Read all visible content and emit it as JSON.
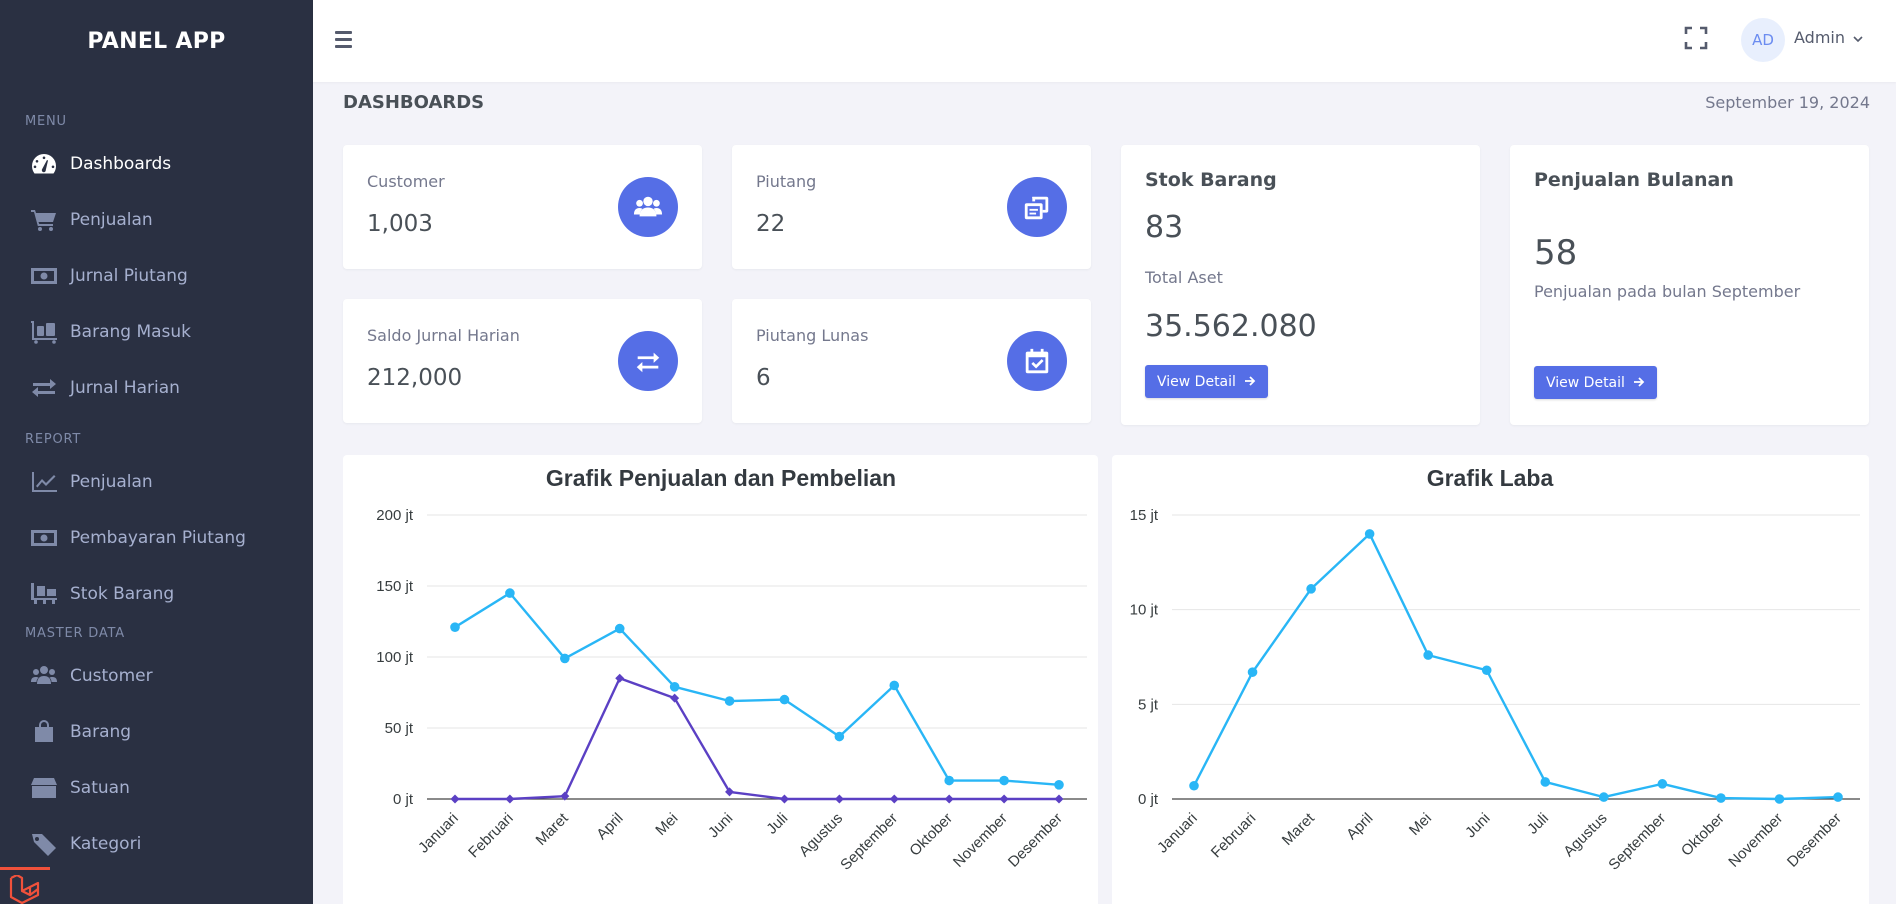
{
  "app": {
    "title": "PANEL APP"
  },
  "sidebar": {
    "sections": {
      "menu": "MENU",
      "report": "REPORT",
      "master": "MASTER DATA"
    },
    "menu_items": [
      {
        "label": "Dashboards",
        "icon": "speedometer-icon",
        "active": true
      },
      {
        "label": "Penjualan",
        "icon": "cart-icon"
      },
      {
        "label": "Jurnal Piutang",
        "icon": "money-icon"
      },
      {
        "label": "Barang Masuk",
        "icon": "luggage-cart-icon"
      },
      {
        "label": "Jurnal Harian",
        "icon": "exchange-icon"
      }
    ],
    "report_items": [
      {
        "label": "Penjualan",
        "icon": "chart-line-icon"
      },
      {
        "label": "Pembayaran Piutang",
        "icon": "money-icon"
      },
      {
        "label": "Stok Barang",
        "icon": "pallet-icon"
      }
    ],
    "master_items": [
      {
        "label": "Customer",
        "icon": "users-icon"
      },
      {
        "label": "Barang",
        "icon": "shopping-bag-icon"
      },
      {
        "label": "Satuan",
        "icon": "box-icon"
      },
      {
        "label": "Kategori",
        "icon": "tag-icon"
      }
    ]
  },
  "topbar": {
    "avatar_initials": "AD",
    "user_name": "Admin"
  },
  "page": {
    "title": "DASHBOARDS",
    "date": "September 19, 2024"
  },
  "stats": {
    "customer": {
      "label": "Customer",
      "value": "1,003",
      "icon": "users-icon"
    },
    "piutang": {
      "label": "Piutang",
      "value": "22",
      "icon": "copy-icon"
    },
    "saldo": {
      "label": "Saldo Jurnal Harian",
      "value": "212,000",
      "icon": "exchange-icon"
    },
    "piutang_lunas": {
      "label": "Piutang Lunas",
      "value": "6",
      "icon": "calendar-check-icon"
    }
  },
  "stok": {
    "title": "Stok Barang",
    "value": "83",
    "aset_label": "Total Aset",
    "aset_value": "35.562.080",
    "button": "View Detail"
  },
  "penjualan_bulanan": {
    "title": "Penjualan Bulanan",
    "value": "58",
    "subtitle": "Penjualan pada bulan September",
    "button": "View Detail"
  },
  "colors": {
    "primary": "#556ee6",
    "sidebar_bg": "#2a3042",
    "series_blue": "#29b6f6",
    "series_purple": "#5b40c4",
    "laravel_red": "#f0513b"
  },
  "chart_data": [
    {
      "type": "line",
      "title": "Grafik Penjualan dan Pembelian",
      "categories": [
        "Januari",
        "Februari",
        "Maret",
        "April",
        "Mei",
        "Juni",
        "Juli",
        "Agustus",
        "September",
        "Oktober",
        "November",
        "Desember"
      ],
      "y_ticks": [
        "0 jt",
        "50 jt",
        "100 jt",
        "150 jt",
        "200 jt"
      ],
      "ylim": [
        0,
        200
      ],
      "grid": true,
      "series": [
        {
          "values": [
            121,
            145,
            99,
            120,
            79,
            69,
            70,
            44,
            80,
            13,
            13,
            10
          ],
          "color": "#29b6f6",
          "marker": "circle"
        },
        {
          "values": [
            0,
            0,
            2,
            85,
            71,
            5,
            0,
            0,
            0,
            0,
            0,
            0
          ],
          "color": "#5b40c4",
          "marker": "diamond"
        }
      ]
    },
    {
      "type": "line",
      "title": "Grafik Laba",
      "categories": [
        "Januari",
        "Februari",
        "Maret",
        "April",
        "Mei",
        "Juni",
        "Juli",
        "Agustus",
        "September",
        "Oktober",
        "November",
        "Desember"
      ],
      "y_ticks": [
        "0 jt",
        "5 jt",
        "10 jt",
        "15 jt"
      ],
      "ylim": [
        0,
        15
      ],
      "grid": true,
      "series": [
        {
          "values": [
            0.7,
            6.7,
            11.1,
            14.0,
            7.6,
            6.8,
            0.9,
            0.1,
            0.8,
            0.05,
            0.0,
            0.1
          ],
          "color": "#29b6f6",
          "marker": "circle"
        }
      ]
    }
  ]
}
